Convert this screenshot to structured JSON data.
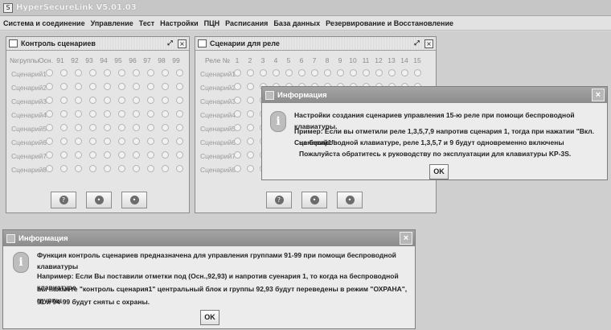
{
  "app": {
    "title": "HyperSecureLink V5.01.03"
  },
  "menu": [
    "Система и соединение",
    "Управление",
    "Тест",
    "Настройки",
    "ПЦН",
    "Расписания",
    "База данных",
    "Резервирование и Восстановление"
  ],
  "scenario_control": {
    "title": "Контроль сценариев",
    "header_label": "№группы",
    "columns": [
      "Осн.",
      "91",
      "92",
      "93",
      "94",
      "95",
      "96",
      "97",
      "98",
      "99"
    ],
    "rows": [
      "Сценарий1",
      "Сценарий2",
      "Сценарий3",
      "Сценарий4",
      "Сценарий5",
      "Сценарий6",
      "Сценарий7",
      "Сценарий8"
    ]
  },
  "relay_scenarios": {
    "title": "Сценарии для реле",
    "header_label": "Реле №",
    "columns": [
      "1",
      "2",
      "3",
      "4",
      "5",
      "6",
      "7",
      "8",
      "9",
      "10",
      "11",
      "12",
      "13",
      "14",
      "15"
    ],
    "rows": [
      "Сценарий1",
      "Сценарий2",
      "Сценарий3",
      "Сценарий4",
      "Сценарий5",
      "Сценарий6",
      "Сценарий7",
      "Сценарий8"
    ]
  },
  "dialog_top": {
    "title": "Информация",
    "line1": "Настройки создания сценариев управления 15-ю реле при помощи беспроводной клавиатуры.",
    "line2": "Пример: Если вы отметили реле 1,3,5,7,9 напротив сценария 1, тогда при нажатии \"Вкл. Сценарий1\"",
    "line3": "на беспроводной клавиатуре, реле 1,3,5,7 и 9 будут одновременно включены",
    "line4": "Пожалуйста обратитесь к руководству по эксплуатации для клавиатуры KP-3S.",
    "ok": "OK"
  },
  "dialog_bottom": {
    "title": "Информация",
    "line1": "Функция контроль сценариев предназначена для управления группами 91-99 при помощи беспроводной клавиатуры",
    "line2": "Например: Если Вы поставили отметки под (Осн.,92,93) и напротив суенария 1, то когда на беспроводной клавиатуре",
    "line3": "вы нажмете \"контроль сценария1\" центральный блок и группы 92,93 будут переведены в режим \"ОХРАНА\", группы",
    "line4": "91 и 94-99 будут сняты с охраны.",
    "ok": "OK"
  }
}
